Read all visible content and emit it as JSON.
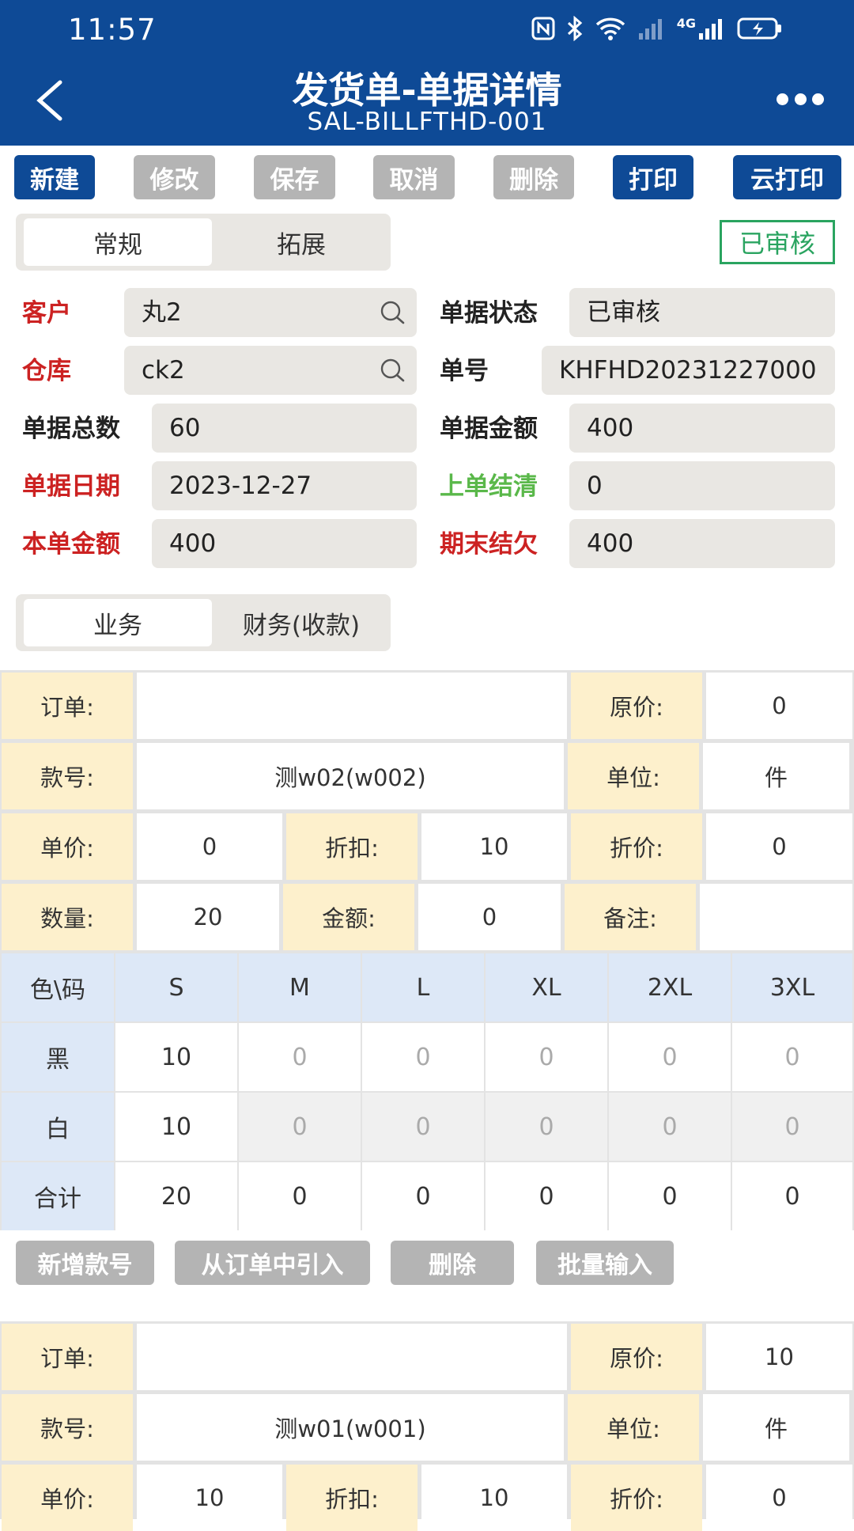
{
  "status_bar": {
    "time": "11:57",
    "network": "4G"
  },
  "header": {
    "title": "发货单-单据详情",
    "subtitle": "SAL-BILLFTHD-001"
  },
  "toolbar": {
    "new": "新建",
    "edit": "修改",
    "save": "保存",
    "cancel": "取消",
    "delete": "删除",
    "print": "打印",
    "cloud_print": "云打印"
  },
  "tabs_main": {
    "general": "常规",
    "extend": "拓展"
  },
  "stamp": "已审核",
  "form": {
    "customer_label": "客户",
    "customer_value": "丸2",
    "doc_status_label": "单据状态",
    "doc_status_value": "已审核",
    "warehouse_label": "仓库",
    "warehouse_value": "ck2",
    "doc_no_label": "单号",
    "doc_no_value": "KHFHD20231227000",
    "total_qty_label": "单据总数",
    "total_qty_value": "60",
    "doc_amount_label": "单据金额",
    "doc_amount_value": "400",
    "doc_date_label": "单据日期",
    "doc_date_value": "2023-12-27",
    "prev_settle_label": "上单结清",
    "prev_settle_value": "0",
    "this_amount_label": "本单金额",
    "this_amount_value": "400",
    "period_owe_label": "期末结欠",
    "period_owe_value": "400"
  },
  "tabs_sub": {
    "business": "业务",
    "finance": "财务(收款)"
  },
  "item1": {
    "order_label": "订单:",
    "order_value": "",
    "orig_price_label": "原价:",
    "orig_price_value": "0",
    "style_label": "款号:",
    "style_value": "测w02(w002)",
    "unit_label": "单位:",
    "unit_value": "件",
    "unit_price_label": "单价:",
    "unit_price_value": "0",
    "discount_label": "折扣:",
    "discount_value": "10",
    "disc_price_label": "折价:",
    "disc_price_value": "0",
    "qty_label": "数量:",
    "qty_value": "20",
    "amount_label": "金额:",
    "amount_value": "0",
    "remark_label": "备注:",
    "remark_value": ""
  },
  "matrix": {
    "corner": "色\\码",
    "sizes": [
      "S",
      "M",
      "L",
      "XL",
      "2XL",
      "3XL"
    ],
    "rows": [
      {
        "color": "黑",
        "values": [
          "10",
          "0",
          "0",
          "0",
          "0",
          "0"
        ]
      },
      {
        "color": "白",
        "values": [
          "10",
          "0",
          "0",
          "0",
          "0",
          "0"
        ]
      },
      {
        "color": "合计",
        "values": [
          "20",
          "0",
          "0",
          "0",
          "0",
          "0"
        ]
      }
    ]
  },
  "actions": {
    "add_style": "新增款号",
    "import_order": "从订单中引入",
    "delete": "删除",
    "batch_input": "批量输入"
  },
  "item2": {
    "order_label": "订单:",
    "order_value": "",
    "orig_price_label": "原价:",
    "orig_price_value": "10",
    "style_label": "款号:",
    "style_value": "测w01(w001)",
    "unit_label": "单位:",
    "unit_value": "件",
    "unit_price_label": "单价:",
    "unit_price_value": "10",
    "discount_label": "折扣:",
    "discount_value": "10",
    "disc_price_label": "折价:",
    "disc_price_value": "0"
  },
  "colors": {
    "header_bg": "#0e4a96",
    "required_label": "#cc2222",
    "green_label": "#5ab84a",
    "stamp": "#2aa460",
    "field_bg": "#e9e7e3",
    "label_cell_bg": "#fdf0cc",
    "matrix_head_bg": "#dde8f7"
  }
}
